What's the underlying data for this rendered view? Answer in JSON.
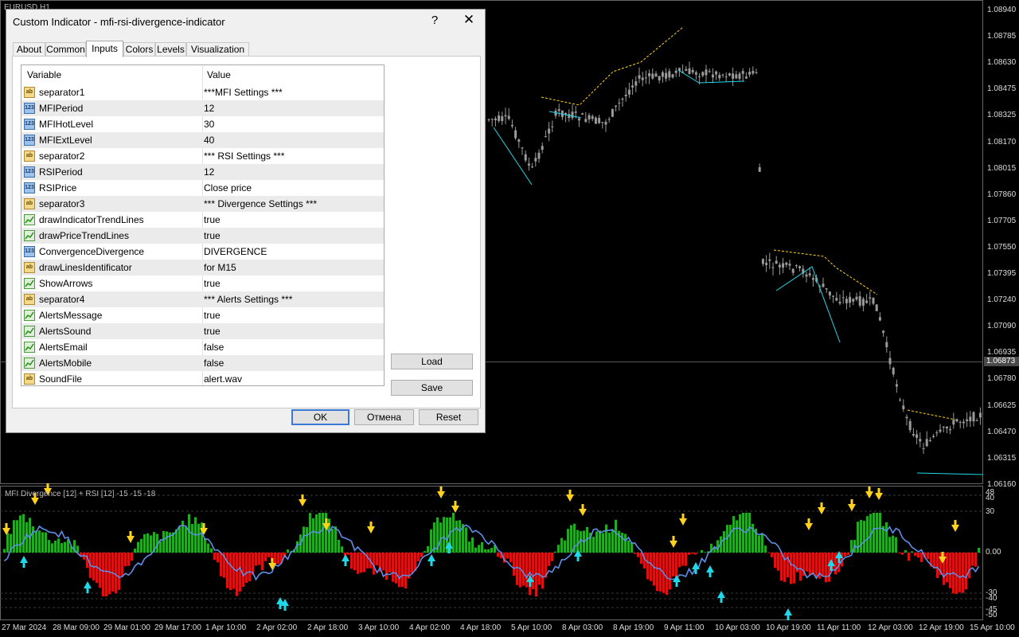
{
  "chart": {
    "symbol": "EURUSD,H1",
    "indicator_label": "MFI Divergence [12] + RSI [12] -15 -15 -18",
    "current_price": "1.06873",
    "price_axis": [
      "1.08940",
      "1.08785",
      "1.08630",
      "1.08475",
      "1.08325",
      "1.08170",
      "1.08015",
      "1.07860",
      "1.07705",
      "1.07550",
      "1.07395",
      "1.07240",
      "1.07090",
      "1.06935",
      "1.06780",
      "1.06625",
      "1.06470",
      "1.06315",
      "1.06160"
    ],
    "indicator_axis": [
      "48",
      "40",
      "30",
      "0.00",
      "-30",
      "-40",
      "-45",
      "-50"
    ],
    "time_axis": [
      "27 Mar 2024",
      "28 Mar 09:00",
      "29 Mar 01:00",
      "29 Mar 17:00",
      "1 Apr 10:00",
      "2 Apr 02:00",
      "2 Apr 18:00",
      "3 Apr 10:00",
      "4 Apr 02:00",
      "4 Apr 18:00",
      "5 Apr 10:00",
      "8 Apr 03:00",
      "8 Apr 19:00",
      "9 Apr 11:00",
      "10 Apr 03:00",
      "10 Apr 19:00",
      "11 Apr 11:00",
      "12 Apr 03:00",
      "12 Apr 19:00",
      "15 Apr 10:00"
    ],
    "colors": {
      "candle": "#9a9a9a",
      "bull_hist": "#22aa22",
      "bear_hist": "#dd1111",
      "rsi_line": "#5f8fe8",
      "bearish_div": "#ffd21e",
      "bullish_div": "#20d8e8",
      "crosshair": "#555555"
    }
  },
  "dialog": {
    "title": "Custom Indicator - mfi-rsi-divergence-indicator",
    "help": "?",
    "close": "✕",
    "tabs": [
      "About",
      "Common",
      "Inputs",
      "Colors",
      "Levels",
      "Visualization"
    ],
    "active_tab": "Inputs",
    "columns": {
      "variable": "Variable",
      "value": "Value"
    },
    "rows": [
      {
        "name": "separator1",
        "value": "***MFI Settings ***",
        "icon": "ab"
      },
      {
        "name": "MFIPeriod",
        "value": "12",
        "icon": "num"
      },
      {
        "name": "MFIHotLevel",
        "value": "30",
        "icon": "num"
      },
      {
        "name": "MFIExtLevel",
        "value": "40",
        "icon": "num"
      },
      {
        "name": "separator2",
        "value": "*** RSI Settings ***",
        "icon": "ab"
      },
      {
        "name": "RSIPeriod",
        "value": "12",
        "icon": "num"
      },
      {
        "name": "RSIPrice",
        "value": "Close price",
        "icon": "num"
      },
      {
        "name": "separator3",
        "value": "*** Divergence Settings ***",
        "icon": "ab"
      },
      {
        "name": "drawIndicatorTrendLines",
        "value": "true",
        "icon": "bool"
      },
      {
        "name": "drawPriceTrendLines",
        "value": "true",
        "icon": "bool"
      },
      {
        "name": "ConvergenceDivergence",
        "value": "DIVERGENCE",
        "icon": "num"
      },
      {
        "name": "drawLinesIdentificator",
        "value": "for M15",
        "icon": "ab"
      },
      {
        "name": "ShowArrows",
        "value": "true",
        "icon": "bool"
      },
      {
        "name": "separator4",
        "value": "*** Alerts Settings ***",
        "icon": "ab"
      },
      {
        "name": "AlertsMessage",
        "value": "true",
        "icon": "bool"
      },
      {
        "name": "AlertsSound",
        "value": "true",
        "icon": "bool"
      },
      {
        "name": "AlertsEmail",
        "value": "false",
        "icon": "bool"
      },
      {
        "name": "AlertsMobile",
        "value": "false",
        "icon": "bool"
      },
      {
        "name": "SoundFile",
        "value": "alert.wav",
        "icon": "ab"
      }
    ],
    "buttons": {
      "load": "Load",
      "save": "Save",
      "ok": "OK",
      "cancel": "Отмена",
      "reset": "Reset"
    }
  }
}
